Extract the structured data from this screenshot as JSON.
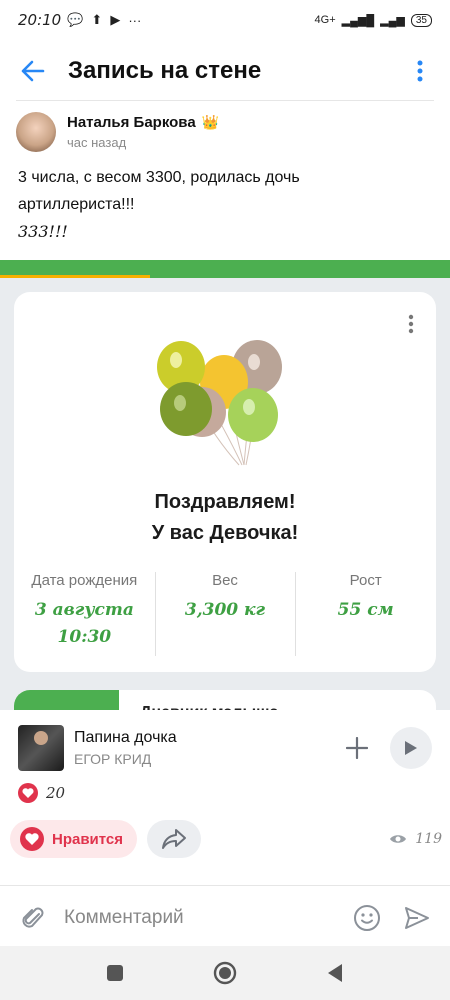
{
  "status_bar": {
    "time": "20:10",
    "battery": "35",
    "network": "4G+"
  },
  "header": {
    "title": "Запись на стене"
  },
  "post": {
    "author_name": "Наталья Баркова",
    "author_badge": "👑",
    "time": "час назад",
    "text_line1": "3 числа, с весом 3300, родилась дочь",
    "text_line2": "артиллериста!!!",
    "text_line3": "333!!!"
  },
  "card": {
    "congrats_line1": "Поздравляем!",
    "congrats_line2": "У вас Девочка!",
    "stats": [
      {
        "label": "Дата рождения",
        "value_line1": "3 августа",
        "value_line2": "10:30"
      },
      {
        "label": "Вес",
        "value_line1": "3,300 кг",
        "value_line2": ""
      },
      {
        "label": "Рост",
        "value_line1": "55 см",
        "value_line2": ""
      }
    ]
  },
  "card2": {
    "title": "Дневник малыша"
  },
  "music": {
    "title": "Папина дочка",
    "artist": "ЕГОР КРИД"
  },
  "reactions": {
    "likes_count": "20",
    "like_label": "Нравится",
    "views_count": "119"
  },
  "comment": {
    "placeholder": "Комментарий"
  },
  "colors": {
    "accent_blue": "#2787f5",
    "green": "#4caf50",
    "like_red": "#e0334c"
  }
}
